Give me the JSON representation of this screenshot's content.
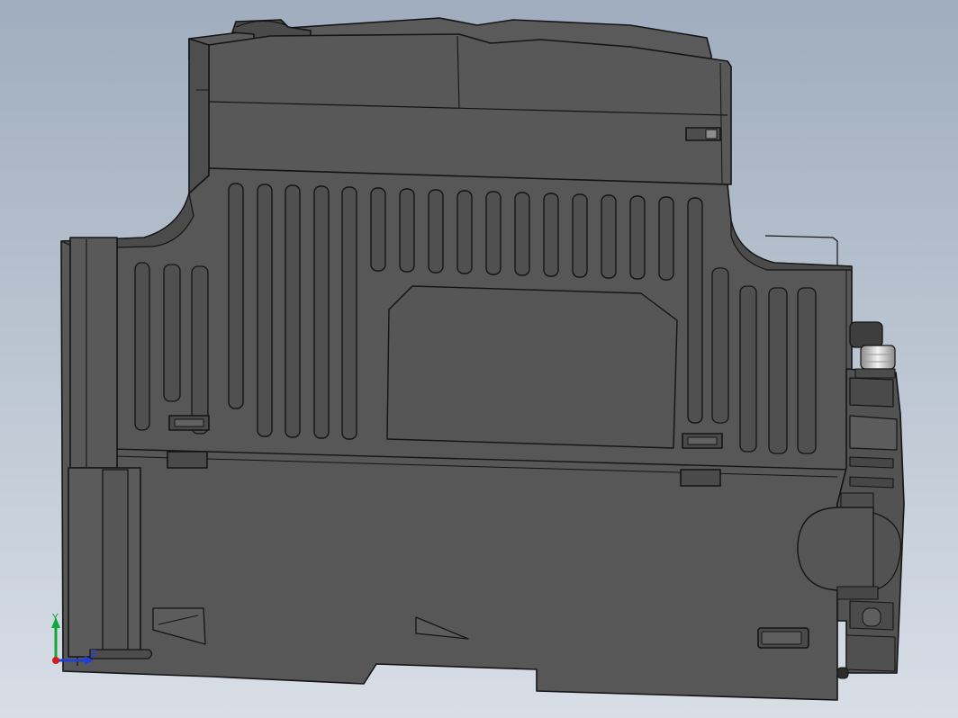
{
  "app": {
    "view": "cad-3d-viewport"
  },
  "colors": {
    "background_top": "#9FADBE",
    "background_bottom": "#D8DEE6",
    "body": "#575757",
    "body_light": "#636363",
    "edge": "#141414",
    "screw_highlight": "#E8E8E8",
    "axis_x": "#1F3FD6",
    "axis_y": "#11A83A",
    "axis_z": "#D01E1E"
  },
  "triad": {
    "y_label": "Y",
    "z_label": "Z",
    "icon": "coordinate-triad-icon"
  }
}
